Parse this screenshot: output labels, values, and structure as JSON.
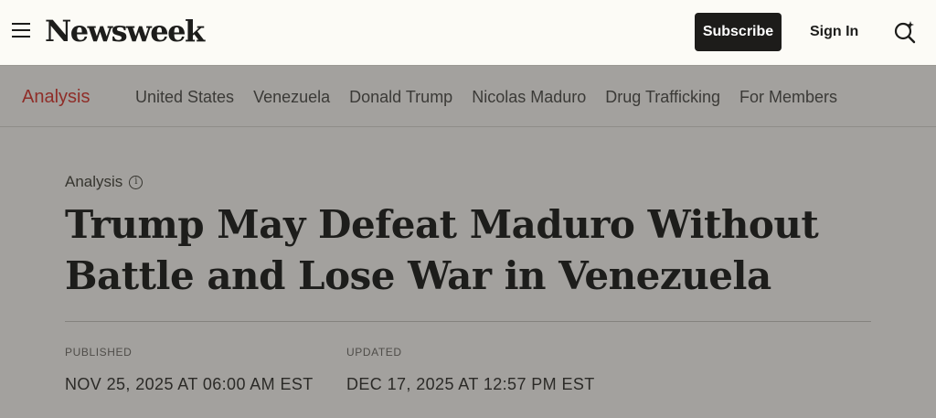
{
  "header": {
    "logo": "Newsweek",
    "subscribe_label": "Subscribe",
    "signin_label": "Sign In",
    "menu_icon": "hamburger-icon",
    "search_icon": "search-sparkle-icon"
  },
  "nav": {
    "active": "Analysis",
    "items": [
      "United States",
      "Venezuela",
      "Donald Trump",
      "Nicolas Maduro",
      "Drug Trafficking",
      "For Members"
    ]
  },
  "article": {
    "kicker": "Analysis",
    "kicker_icon": "info-icon",
    "headline": "Trump May Defeat Maduro Without Battle and Lose War in Venezuela",
    "published_label": "PUBLISHED",
    "published_value": "NOV 25, 2025 AT 06:00 AM EST",
    "updated_label": "UPDATED",
    "updated_value": "DEC 17, 2025 AT 12:57 PM EST"
  },
  "colors": {
    "overlay_bg": "#a3a19e",
    "header_bg": "#fcfbf6",
    "accent_red": "#8f2d28",
    "button_dark": "#1d1c1a"
  }
}
